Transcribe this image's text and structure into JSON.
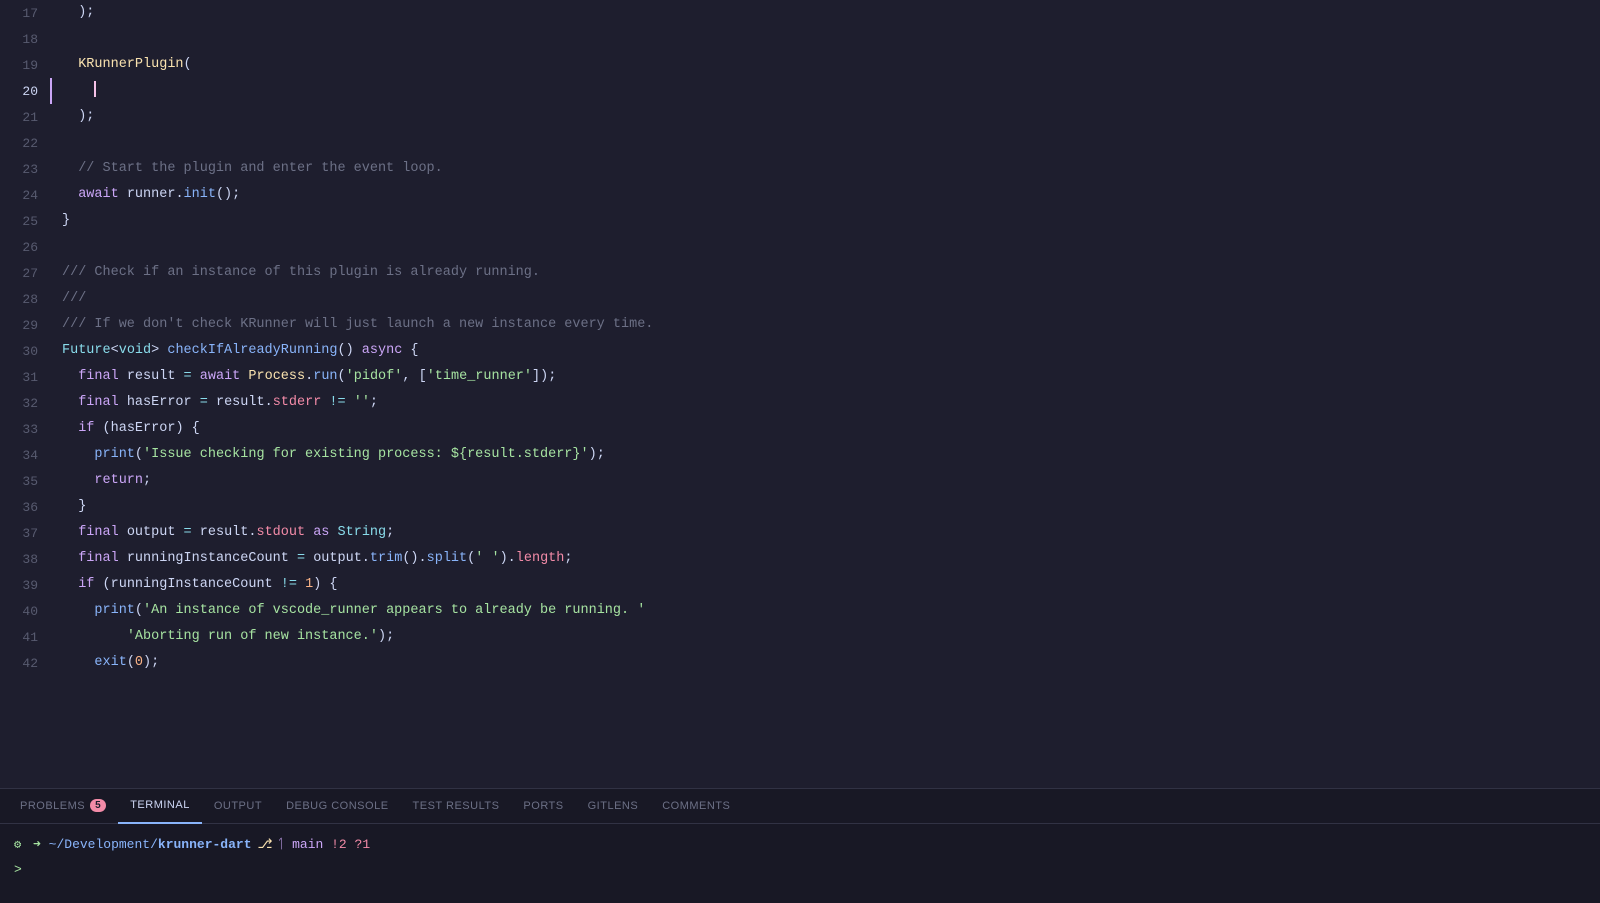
{
  "colors": {
    "bg": "#1e1e2e",
    "panel_bg": "#181825",
    "active_tab_color": "#89b4fa",
    "text_default": "#cdd6f4",
    "muted": "#6c7086"
  },
  "tabs": [
    {
      "id": "problems",
      "label": "PROBLEMS",
      "active": false,
      "badge": "5"
    },
    {
      "id": "terminal",
      "label": "TERMINAL",
      "active": true,
      "badge": ""
    },
    {
      "id": "output",
      "label": "OUTPUT",
      "active": false,
      "badge": ""
    },
    {
      "id": "debug-console",
      "label": "DEBUG CONSOLE",
      "active": false,
      "badge": ""
    },
    {
      "id": "test-results",
      "label": "TEST RESULTS",
      "active": false,
      "badge": ""
    },
    {
      "id": "ports",
      "label": "PORTS",
      "active": false,
      "badge": ""
    },
    {
      "id": "gitlens",
      "label": "GITLENS",
      "active": false,
      "badge": ""
    },
    {
      "id": "comments",
      "label": "COMMENTS",
      "active": false,
      "badge": ""
    }
  ],
  "terminal": {
    "path_display": "~/Development/krunner-dart",
    "branch": "main",
    "status": "!2 ?1",
    "prompt_char": ">"
  }
}
